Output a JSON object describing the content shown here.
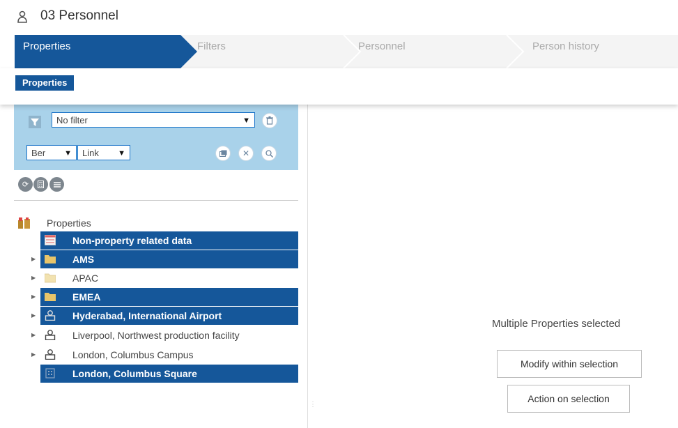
{
  "header": {
    "title": "03 Personnel",
    "icon": "person-icon"
  },
  "wizard": {
    "steps": [
      {
        "label": "Properties",
        "active": true
      },
      {
        "label": "Filters",
        "active": false
      },
      {
        "label": "Personnel",
        "active": false
      },
      {
        "label": "Person history",
        "active": false
      }
    ],
    "active_color": "#15579a"
  },
  "subtab": {
    "label": "Properties"
  },
  "filter": {
    "filter_select": "No filter",
    "select_a": "Ber",
    "select_b": "Link",
    "icons": [
      "funnel-icon",
      "delete-icon",
      "window-icon",
      "clear-icon",
      "search-icon"
    ]
  },
  "toolbar_icons": [
    "refresh-icon",
    "calculator-icon",
    "list-icon"
  ],
  "tree": {
    "root_label": "Properties",
    "items": [
      {
        "label": "Non-property related data",
        "selected": true,
        "icon": "data-icon",
        "expandable": false
      },
      {
        "label": "AMS",
        "selected": true,
        "icon": "folder-icon",
        "expandable": true
      },
      {
        "label": "APAC",
        "selected": false,
        "icon": "folder-icon",
        "expandable": true
      },
      {
        "label": "EMEA",
        "selected": true,
        "icon": "folder-icon",
        "expandable": true
      },
      {
        "label": "Hyderabad, International Airport",
        "selected": true,
        "icon": "property-icon",
        "expandable": true
      },
      {
        "label": "Liverpool, Northwest production facility",
        "selected": false,
        "icon": "property-icon",
        "expandable": true
      },
      {
        "label": "London, Columbus Campus",
        "selected": false,
        "icon": "property-icon",
        "expandable": true
      },
      {
        "label": "London, Columbus Square",
        "selected": true,
        "icon": "building-icon",
        "expandable": false
      }
    ]
  },
  "main": {
    "message": "Multiple Properties selected",
    "modify_button": "Modify within selection",
    "action_button": "Action on selection"
  }
}
